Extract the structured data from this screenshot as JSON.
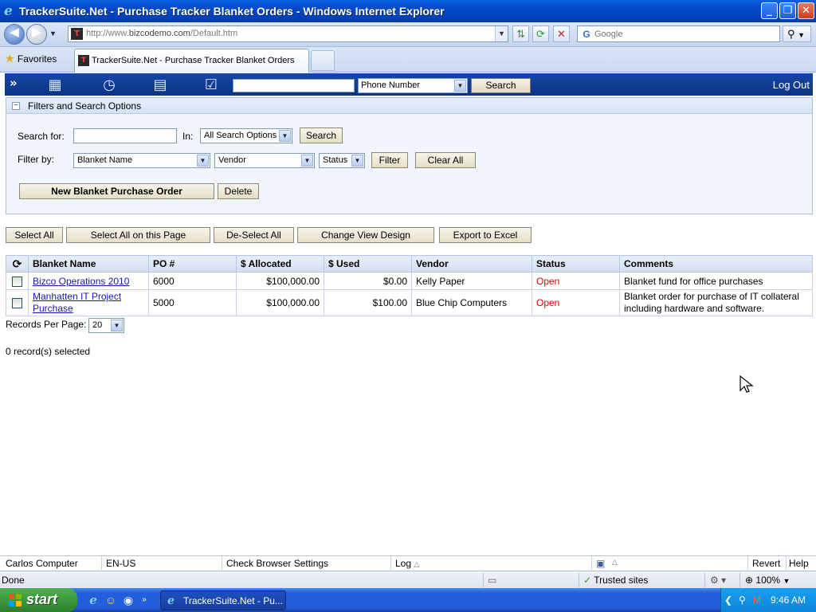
{
  "window": {
    "title": "TrackerSuite.Net - Purchase Tracker Blanket Orders - Windows Internet Explorer",
    "minimize": "_",
    "restore": "❐",
    "close": "✕"
  },
  "browser": {
    "url_prefix": "http://www.",
    "url_host": "bizcodemo.com",
    "url_path": "/Default.htm",
    "search_placeholder": "Google",
    "favorites_label": "Favorites",
    "tab_title": "TrackerSuite.Net - Purchase Tracker Blanket Orders",
    "status_text": "Done",
    "zone": "Trusted sites",
    "zoom": "100%"
  },
  "toolbar": {
    "quick_search_option": "Phone Number",
    "search_label": "Search",
    "logout_label": "Log Out"
  },
  "filters": {
    "header": "Filters and Search Options",
    "search_for_label": "Search for:",
    "in_label": "In:",
    "in_option": "All Search Options",
    "search_button": "Search",
    "filter_by_label": "Filter by:",
    "filter1": "Blanket Name",
    "filter2": "Vendor",
    "filter3": "Status",
    "filter_button": "Filter",
    "clear_button": "Clear All",
    "new_button": "New Blanket Purchase Order",
    "delete_button": "Delete"
  },
  "actions": {
    "select_all": "Select All",
    "select_page": "Select All on this Page",
    "deselect_all": "De-Select All",
    "change_view": "Change View Design",
    "export": "Export to Excel"
  },
  "grid": {
    "columns": [
      "Blanket Name",
      "PO #",
      "$ Allocated",
      "$ Used",
      "Vendor",
      "Status",
      "Comments"
    ],
    "rows": [
      {
        "name": "Bizco Operations 2010",
        "po": "6000",
        "allocated": "$100,000.00",
        "used": "$0.00",
        "vendor": "Kelly Paper",
        "status": "Open",
        "comments": "Blanket fund for office purchases"
      },
      {
        "name": "Manhatten IT Project Purchase",
        "po": "5000",
        "allocated": "$100,000.00",
        "used": "$100.00",
        "vendor": "Blue Chip Computers",
        "status": "Open",
        "comments": "Blanket order for purchase of IT collateral including hardware and software."
      }
    ],
    "records_per_page_label": "Records Per Page:",
    "records_per_page": "20",
    "selected_count": "0 record(s) selected"
  },
  "footer": {
    "user": "Carlos Computer",
    "locale": "EN-US",
    "check_browser": "Check Browser Settings",
    "log": "Log",
    "revert": "Revert",
    "help": "Help"
  },
  "taskbar": {
    "start": "start",
    "task_title": "TrackerSuite.Net - Pu...",
    "clock": "9:46 AM"
  },
  "colors": {
    "status_open": "#e00000",
    "link": "#1a1aa8",
    "toolbar_blue": "#0b3386"
  }
}
